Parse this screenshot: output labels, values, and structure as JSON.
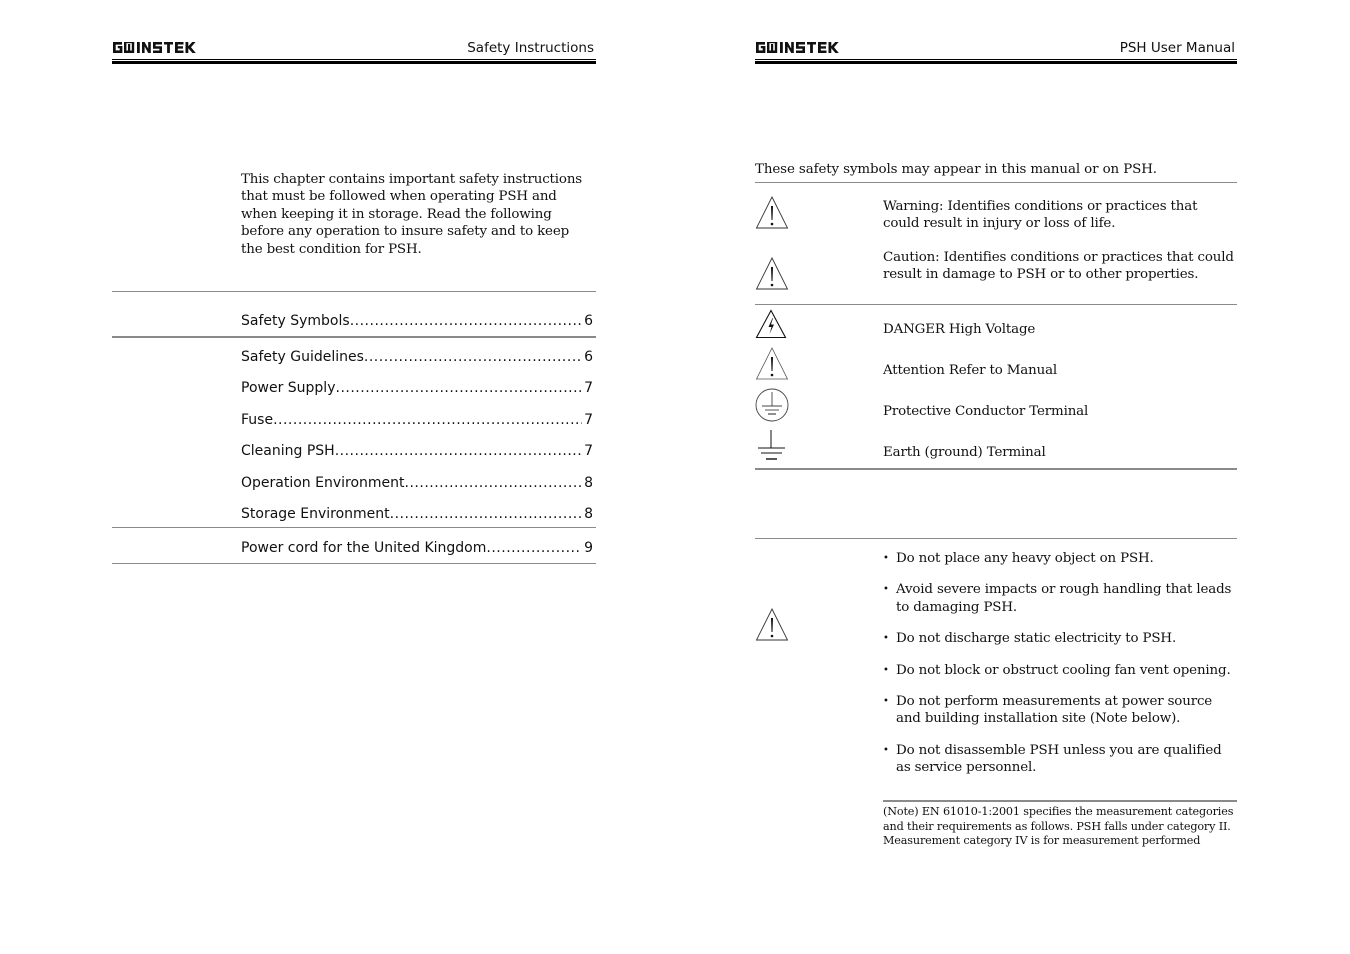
{
  "left_page": {
    "header": {
      "brand": "GW INSTEK",
      "title": "Safety Instructions"
    },
    "intro": "This chapter contains important safety instructions that must be followed when operating PSH and when keeping it in storage. Read the following before any operation to insure safety and to keep the best condition for PSH.",
    "toc": [
      {
        "label": "Safety Symbols",
        "page": "6"
      },
      {
        "label": "Safety Guidelines",
        "page": "6"
      },
      {
        "label": "Power Supply",
        "page": "7"
      },
      {
        "label": "Fuse",
        "page": "7"
      },
      {
        "label": "Cleaning PSH",
        "page": "7"
      },
      {
        "label": "Operation Environment",
        "page": "8"
      },
      {
        "label": "Storage Environment",
        "page": "8"
      },
      {
        "label": "Power cord for the United Kingdom",
        "page": "9"
      }
    ]
  },
  "right_page": {
    "header": {
      "brand": "GW INSTEK",
      "title": "PSH User Manual"
    },
    "symbols_intro": "These safety symbols may appear in this manual or on PSH.",
    "symbols": [
      {
        "icon": "warning-triangle-icon",
        "text": "Warning: Identifies conditions or practices that could result in injury or loss of life."
      },
      {
        "icon": "caution-triangle-icon",
        "text": "Caution: Identifies conditions or practices that could result in damage to PSH or to other properties."
      },
      {
        "icon": "high-voltage-icon",
        "text": "DANGER High Voltage"
      },
      {
        "icon": "attention-triangle-icon",
        "text": "Attention Refer to Manual"
      },
      {
        "icon": "protective-conductor-icon",
        "text": "Protective Conductor Terminal"
      },
      {
        "icon": "earth-ground-icon",
        "text": "Earth (ground) Terminal"
      }
    ],
    "guidelines": {
      "icon": "caution-triangle-icon",
      "bullets": [
        "Do not place any heavy object on PSH.",
        "Avoid severe impacts or rough handling that leads to damaging PSH.",
        "Do not discharge static electricity to PSH.",
        "Do not block or obstruct cooling fan vent opening.",
        "Do not perform measurements at power source and building installation site (Note below).",
        "Do not disassemble PSH unless you are qualified as service personnel."
      ],
      "note_lines": [
        "(Note) EN 61010-1:2001 specifies the measurement categories and their requirements as follows. PSH falls under category II.",
        "Measurement category IV is for measurement performed"
      ]
    }
  }
}
